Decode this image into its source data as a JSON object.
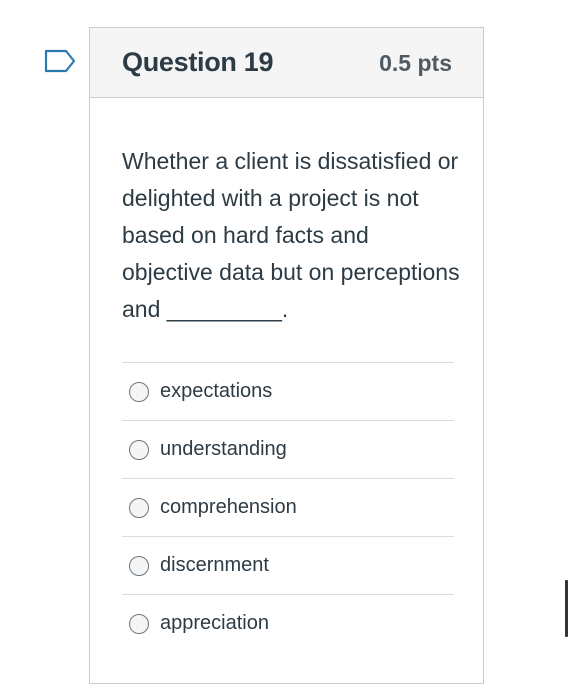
{
  "question": {
    "title": "Question 19",
    "points": "0.5 pts",
    "text": "Whether a client is dissatisfied or delighted with a project is not based on hard facts and objective data but on perceptions and _________."
  },
  "answers": [
    {
      "label": "expectations",
      "selected": false
    },
    {
      "label": "understanding",
      "selected": false
    },
    {
      "label": "comprehension",
      "selected": false
    },
    {
      "label": "discernment",
      "selected": false
    },
    {
      "label": "appreciation",
      "selected": false
    }
  ],
  "icons": {
    "flag": "flag-outline-icon"
  },
  "colors": {
    "flag_accent": "#2a7ab0",
    "header_bg": "#f5f5f5",
    "border": "#c7cdd1",
    "text": "#2d3b45"
  }
}
